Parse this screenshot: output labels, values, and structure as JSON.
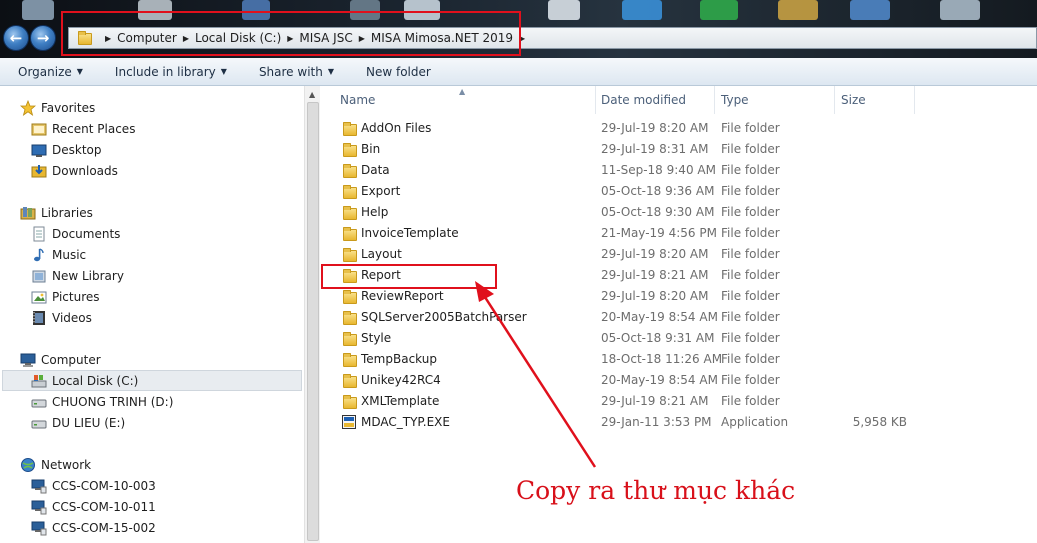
{
  "address_bar": {
    "crumbs": [
      "Computer",
      "Local Disk (C:)",
      "MISA JSC",
      "MISA Mimosa.NET 2019"
    ]
  },
  "toolbar": {
    "items": [
      "Organize",
      "Include in library",
      "Share with",
      "New folder"
    ]
  },
  "navigation": {
    "favorites": {
      "label": "Favorites",
      "items": [
        "Recent Places",
        "Desktop",
        "Downloads"
      ]
    },
    "libraries": {
      "label": "Libraries",
      "items": [
        "Documents",
        "Music",
        "New Library",
        "Pictures",
        "Videos"
      ]
    },
    "computer": {
      "label": "Computer",
      "items": [
        "Local Disk (C:)",
        "CHUONG TRINH (D:)",
        "DU LIEU (E:)"
      ],
      "selected": "Local Disk (C:)"
    },
    "network": {
      "label": "Network",
      "items": [
        "CCS-COM-10-003",
        "CCS-COM-10-011",
        "CCS-COM-15-002"
      ]
    }
  },
  "file_list": {
    "columns": [
      "Name",
      "Date modified",
      "Type",
      "Size"
    ],
    "rows": [
      {
        "name": "AddOn Files",
        "date": "29-Jul-19 8:20 AM",
        "type": "File folder",
        "size": "",
        "icon": "folder-icon"
      },
      {
        "name": "Bin",
        "date": "29-Jul-19 8:31 AM",
        "type": "File folder",
        "size": "",
        "icon": "folder-icon"
      },
      {
        "name": "Data",
        "date": "11-Sep-18 9:40 AM",
        "type": "File folder",
        "size": "",
        "icon": "folder-icon"
      },
      {
        "name": "Export",
        "date": "05-Oct-18 9:36 AM",
        "type": "File folder",
        "size": "",
        "icon": "folder-icon"
      },
      {
        "name": "Help",
        "date": "05-Oct-18 9:30 AM",
        "type": "File folder",
        "size": "",
        "icon": "folder-icon"
      },
      {
        "name": "InvoiceTemplate",
        "date": "21-May-19 4:56 PM",
        "type": "File folder",
        "size": "",
        "icon": "folder-icon"
      },
      {
        "name": "Layout",
        "date": "29-Jul-19 8:20 AM",
        "type": "File folder",
        "size": "",
        "icon": "folder-icon"
      },
      {
        "name": "Report",
        "date": "29-Jul-19 8:21 AM",
        "type": "File folder",
        "size": "",
        "icon": "folder-icon"
      },
      {
        "name": "ReviewReport",
        "date": "29-Jul-19 8:20 AM",
        "type": "File folder",
        "size": "",
        "icon": "folder-icon"
      },
      {
        "name": "SQLServer2005BatchParser",
        "date": "20-May-19 8:54 AM",
        "type": "File folder",
        "size": "",
        "icon": "folder-icon"
      },
      {
        "name": "Style",
        "date": "05-Oct-18 9:31 AM",
        "type": "File folder",
        "size": "",
        "icon": "folder-icon"
      },
      {
        "name": "TempBackup",
        "date": "18-Oct-18 11:26 AM",
        "type": "File folder",
        "size": "",
        "icon": "folder-icon"
      },
      {
        "name": "Unikey42RC4",
        "date": "20-May-19 8:54 AM",
        "type": "File folder",
        "size": "",
        "icon": "folder-icon"
      },
      {
        "name": "XMLTemplate",
        "date": "29-Jul-19 8:21 AM",
        "type": "File folder",
        "size": "",
        "icon": "folder-icon"
      },
      {
        "name": "MDAC_TYP.EXE",
        "date": "29-Jan-11 3:53 PM",
        "type": "Application",
        "size": "5,958 KB",
        "icon": "installer-icon"
      }
    ]
  },
  "annotation": {
    "text": "Copy ra thư mục khác",
    "color": "#d8101a"
  }
}
